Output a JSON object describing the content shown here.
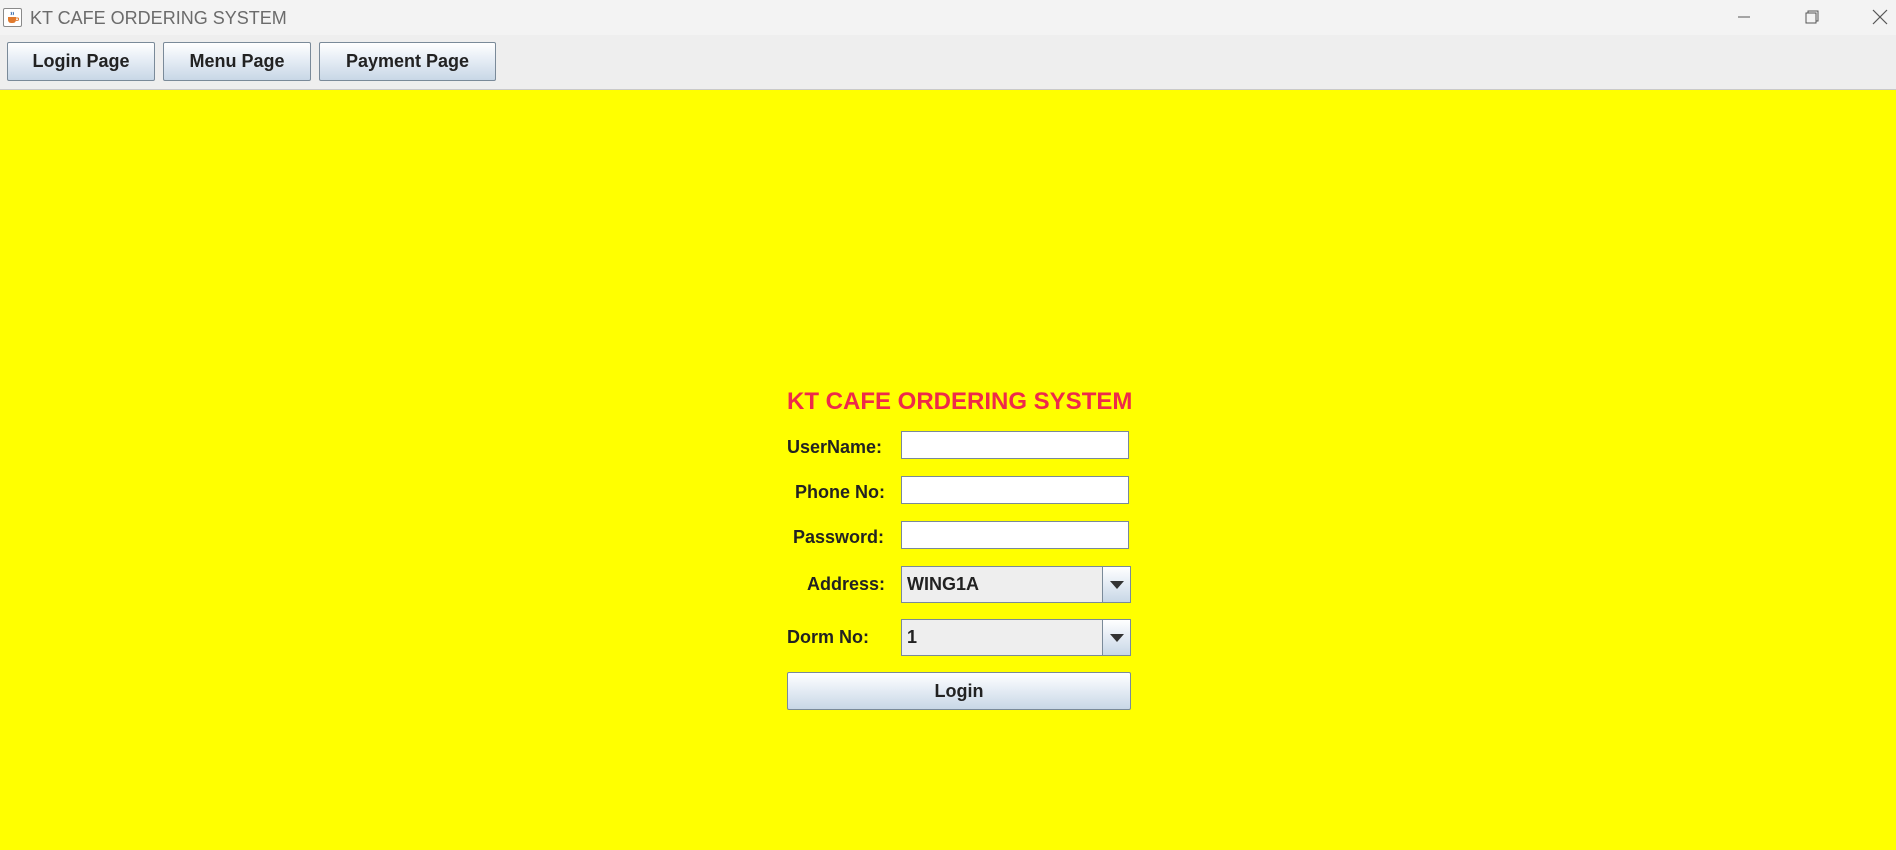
{
  "window": {
    "title": "KT CAFE ORDERING SYSTEM"
  },
  "toolbar": {
    "buttons": [
      {
        "label": "Login Page"
      },
      {
        "label": "Menu Page"
      },
      {
        "label": "Payment Page"
      }
    ]
  },
  "login_form": {
    "title": "KT CAFE ORDERING SYSTEM",
    "username_label": "UserName:",
    "username_value": "",
    "phone_label": "Phone No:",
    "phone_value": "",
    "password_label": "Password:",
    "password_value": "",
    "address_label": "Address:",
    "address_selected": "WING1A",
    "dorm_label": "Dorm No:",
    "dorm_selected": "1",
    "login_label": "Login"
  },
  "colors": {
    "background": "#ffff00",
    "title": "#ee2a4a"
  },
  "icons": {
    "app": "java-coffee-icon",
    "minimize": "minimize-icon",
    "maximize": "restore-icon",
    "close": "close-icon",
    "dropdown": "chevron-down-icon"
  }
}
